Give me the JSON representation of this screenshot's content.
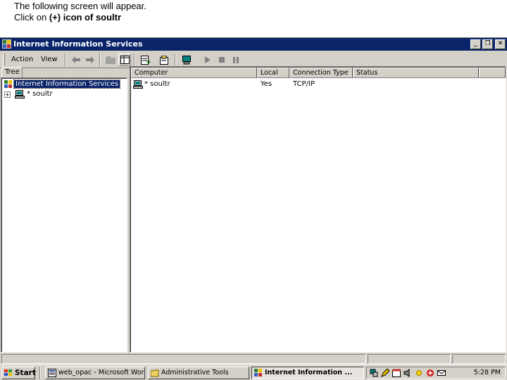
{
  "caption": {
    "line1": "The following screen will appear.",
    "line2_prefix": "Click on ",
    "line2_bold": "(+) icon of soultr"
  },
  "window": {
    "title": "Internet Information Services",
    "buttons": {
      "minimize": "_",
      "restore": "❐",
      "close": "✕"
    }
  },
  "toolbar": {
    "menu": [
      "Action",
      "View"
    ],
    "icons": [
      "back-icon",
      "forward-icon",
      "up-icon",
      "show-hide-tree-icon",
      "export-list-icon",
      "properties-icon",
      "computer-icon",
      "start-icon",
      "stop-icon",
      "pause-icon"
    ]
  },
  "tree": {
    "tab_label": "Tree",
    "root_label": "Internet Information Services",
    "child_label": "* soultr",
    "expander": "+"
  },
  "list": {
    "columns": [
      "Computer",
      "Local",
      "Connection Type",
      "Status"
    ],
    "rows": [
      {
        "computer": "* soultr",
        "local": "Yes",
        "connection_type": "TCP/IP",
        "status": ""
      }
    ]
  },
  "taskbar": {
    "start_label": "Start",
    "tasks": [
      "web_opac - Microsoft Word",
      "Administrative Tools",
      "Internet Information ..."
    ],
    "active_task": 2,
    "clock": "5:28 PM"
  },
  "colors": {
    "titlebar": "#0a246a",
    "chrome": "#d4d0c8",
    "selection": "#0a246a"
  }
}
